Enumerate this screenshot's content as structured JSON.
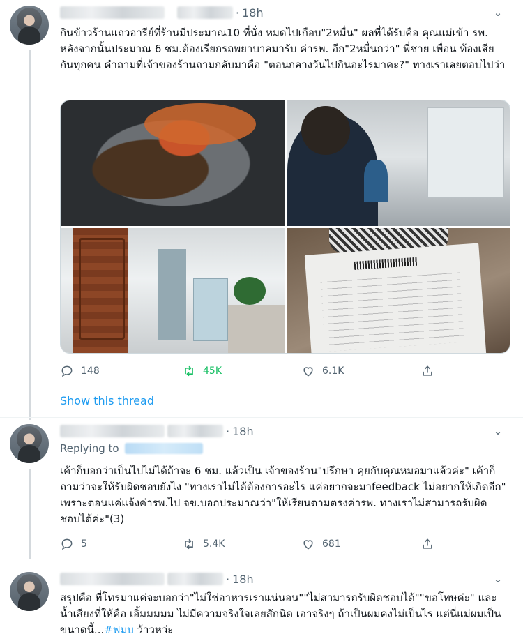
{
  "tweets": [
    {
      "time": "18h",
      "text": "กินข้าวร้านแถวอารีย์ที่ร้านมีประมาณ10 ที่นั่ง หมดไปเกือบ\"2หมื่น\" ผลที่ได้รับคือ คุณแม่เข้า รพ. หลังจากนั้นประมาณ 6 ชม.ต้องเรียกรถพยาบาลมารับ ค่ารพ. อีก\"2หมื่นกว่า\" พี่ชาย เพื่อน ท้องเสียกันทุกคน คำถามที่เจ้าของร้านถามกลับมาคือ \"ตอนกลางวันไปกินอะไรมาคะ?\" ทางเราเลยตอบไปว่า",
      "replies": "148",
      "retweets": "45K",
      "likes": "6.1K",
      "show_thread": "Show this thread"
    },
    {
      "time": "18h",
      "replying_to": "Replying to",
      "text": "เค้าก็บอกว่าเป็นไปไม่ได้ถ้าจะ 6 ชม. แล้วเป็น เจ้าของร้าน\"ปรึกษา คุยกับคุณหมอมาแล้วค่ะ\" เค้าก็ถามว่าจะให้รับผิดชอบยังไง \"ทางเราไม่ได้ต้องการอะไร แค่อยากจะมาfeedback ไม่อยากให้เกิดอีก\" เพราะตอนแค่แจ้งค่ารพ.ไป จข.บอกประมาณว่า\"ให้เรียนตามตรงค่ารพ. ทางเราไม่สามารถรับผิดชอบได้ค่ะ\"(3)",
      "replies": "5",
      "retweets": "5.4K",
      "likes": "681"
    },
    {
      "time": "18h",
      "text": "สรุปคือ ที่โทรมาแค่จะบอกว่า\"ไม่ใช่อาหารเราแน่นอน\"\"ไม่สามารถรับผิดชอบได้\"\"ขอโทษค่ะ\" และน้ำเสียงที่ให้คือ เอิ้มมมมม ไม่มีความจริงใจเลยสักนิด เอาจริงๆ ถ้าเป็นผมคงไม่เป็นไร แต่นี่แม่ผมเป็นขนาดนี้...",
      "hashtag": "#ฟมบ",
      "tail": " ว้าวหว่ะ"
    }
  ],
  "colors": {
    "accent": "#1d9bf0",
    "retweet": "#17bf63",
    "muted": "#536471"
  },
  "icons": [
    "reply-icon",
    "retweet-icon",
    "like-icon",
    "share-icon",
    "chevron-down-icon"
  ]
}
